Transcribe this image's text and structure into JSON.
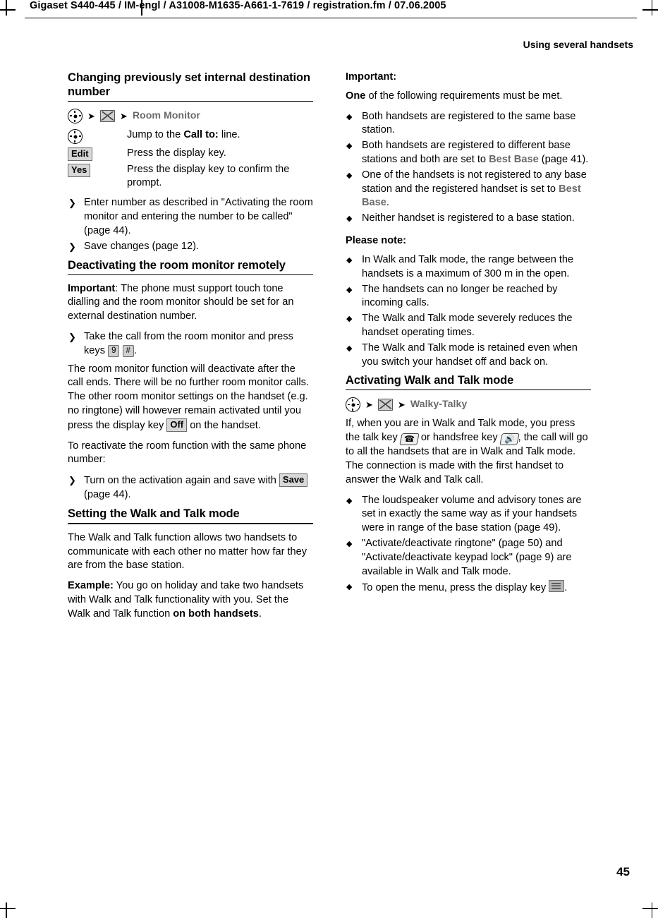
{
  "header": {
    "file_line": "Gigaset S440-445 / IM-engl / A31008-M1635-A661-1-7619 / registration.fm / 07.06.2005",
    "running_head": "Using several handsets"
  },
  "page_number": "45",
  "icons": {
    "nav_key": "navigation-key-icon",
    "menu_key": "menu-key-icon",
    "arrow": "➔",
    "display_key_menu": "display-key-menu-icon"
  },
  "left_column": {
    "section1": {
      "title": "Changing previously set internal destination number",
      "menu_path": [
        "Room Monitor"
      ],
      "steps": [
        {
          "key": "",
          "key_type": "nav",
          "text": "Jump to the Call to: line.",
          "bold_part": "Call to:"
        },
        {
          "key": "Edit",
          "key_type": "dkey",
          "text": "Press the display key."
        },
        {
          "key": "Yes",
          "key_type": "dkey",
          "text": "Press the display key to confirm the prompt."
        }
      ],
      "bullets": [
        "Enter number as described in \"Activating the room monitor and entering the number to be called\" (page 44).",
        "Save changes (page 12)."
      ]
    },
    "section2": {
      "title": "Deactivating the room monitor remotely",
      "para1_bold": "Important",
      "para1": ": The phone must support touch tone dialling and the room monitor should be set for an external destination number.",
      "bullet1_prefix": "Take the call from the room monitor and press keys",
      "bullet1_key1": "9",
      "bullet1_key2": "#",
      "bullet1_suffix": ".",
      "para2_a": "The room monitor function will deactivate after the call ends. There will be no further room monitor calls. The other room monitor settings on the handset (e.g. no ringtone) will however remain activated until you press the display key",
      "para2_key": "Off",
      "para2_b": "on the handset.",
      "para3": "To reactivate the room function with the same phone number:",
      "bullet2_a": "Turn on the activation again and save with",
      "bullet2_key": "Save",
      "bullet2_b": "(page 44)."
    },
    "section3": {
      "title": "Setting the Walk and Talk mode",
      "para1": "The Walk and Talk function allows two handsets to communicate with each other no matter how far they are from the base station.",
      "para2_bold": "Example:",
      "para2": " You go on holiday and take two handsets with Walk and Talk functionality with you. Set the Walk and Talk function ",
      "para2_bold2": "on both handsets",
      "para2_end": "."
    }
  },
  "right_column": {
    "important": {
      "heading": "Important:",
      "intro_bold": "One",
      "intro": " of the following requirements must be met.",
      "bullets": [
        {
          "text": "Both handsets are registered to the same base station."
        },
        {
          "pre": "Both handsets are registered to different base stations and both are set to ",
          "mono": "Best Base",
          "post": " (page 41)."
        },
        {
          "pre": "One of the handsets is not registered to any base station and the registered handset is set to ",
          "mono": "Best Base",
          "post": "."
        },
        {
          "text": "Neither handset is registered to a base station."
        }
      ]
    },
    "please_note": {
      "heading": "Please note:",
      "bullets": [
        "In Walk and Talk mode, the range between the handsets is a maximum of 300 m in the open.",
        "The handsets can no longer be reached by incoming calls.",
        "The Walk and Talk mode severely reduces the handset operating times.",
        "The Walk and Talk mode is retained even when you switch your handset off and back on."
      ]
    },
    "activating": {
      "title": "Activating Walk and Talk mode",
      "menu_path": [
        "Walky-Talky"
      ],
      "para1_a": "If, when you are in Walk and Talk mode, you press the talk key",
      "para1_b": "or handsfree key",
      "para1_c": ", the call will go to all the handsets that are in Walk and Talk mode. The connection is made with the first handset to answer the Walk and Talk call.",
      "bullets": [
        {
          "text": "The loudspeaker volume and advisory tones are set in exactly the same way as if your handsets were in range of the base station (page 49)."
        },
        {
          "text": "\"Activate/deactivate ringtone\" (page 50) and \"Activate/deactivate keypad lock\" (page 9) are available in Walk and Talk mode."
        },
        {
          "pre": "To open the menu, press the display key ",
          "icon": "display-key-menu-icon",
          "post": "."
        }
      ]
    }
  }
}
